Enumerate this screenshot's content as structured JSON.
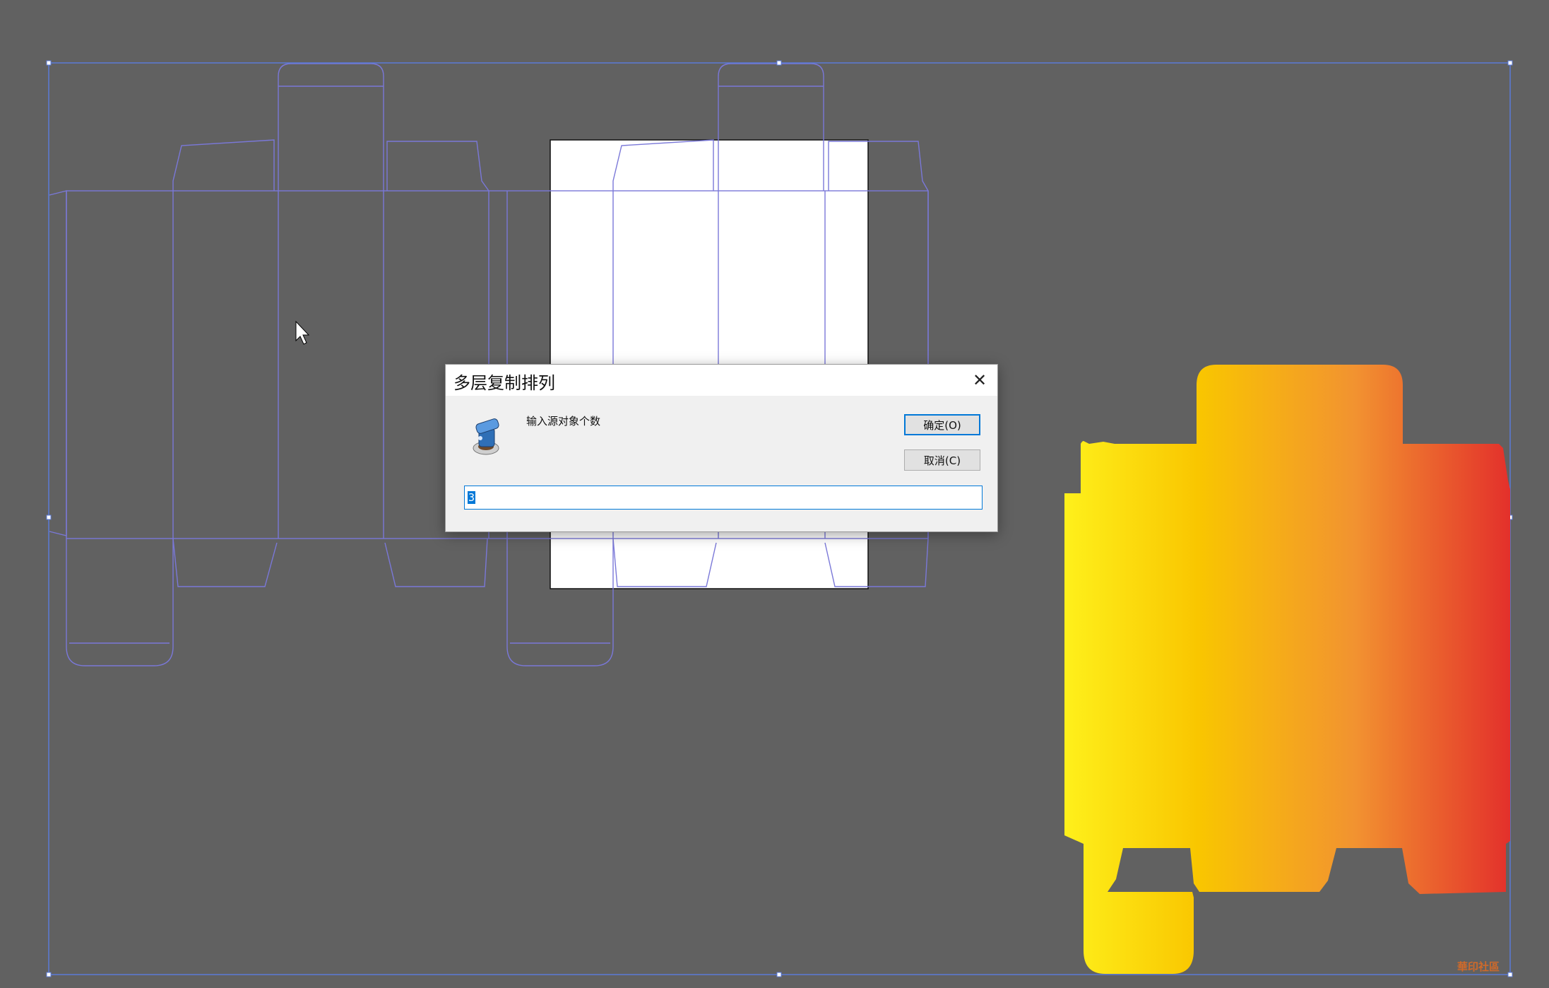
{
  "dialog": {
    "title": "多层复制排列",
    "close_glyph": "✕",
    "prompt": "输入源对象个数",
    "ok_label": "确定(O)",
    "cancel_label": "取消(C)",
    "input_value": "3"
  },
  "watermark": {
    "text": "華印社區"
  },
  "colors": {
    "canvas_bg": "#616161",
    "selection_frame": "#5b7bd8",
    "dieline": "#7a78d8",
    "gradient_start": "#fef01b",
    "gradient_mid": "#f9c600",
    "gradient_end": "#e3302b",
    "accent": "#0078d7"
  },
  "icons": {
    "dialog_icon": "tool-icon",
    "cursor": "arrow-cursor-icon",
    "close": "close-icon"
  }
}
